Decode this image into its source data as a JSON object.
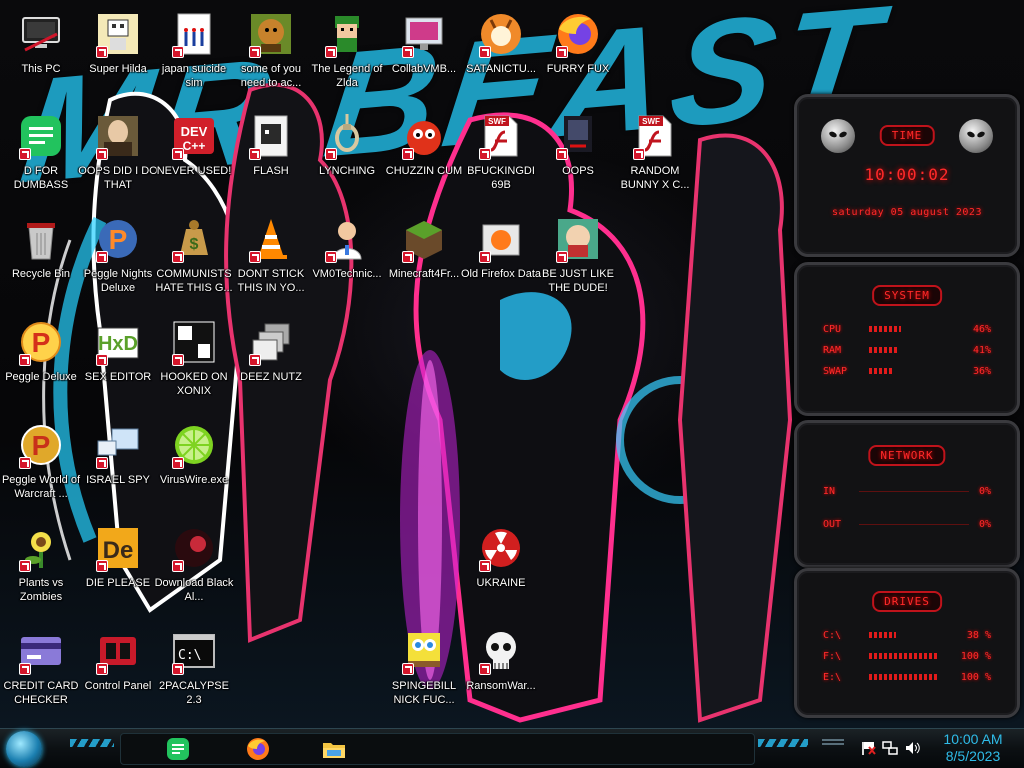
{
  "wallpaper": {
    "title_text": "MR BEAST",
    "accent": "#1fa3c8"
  },
  "desktop_icons": [
    {
      "label": "This PC",
      "icon": "pc-icon"
    },
    {
      "label": "Super Hilda",
      "icon": "super-hilda-icon"
    },
    {
      "label": "japan suicide sim",
      "icon": "japan-suicide-sim-icon"
    },
    {
      "label": "some of you need to ac...",
      "icon": "dog-game-icon"
    },
    {
      "label": "The Legend of Zlda",
      "icon": "zelda-icon"
    },
    {
      "label": "CollabVMB...",
      "icon": "collabvm-icon"
    },
    {
      "label": "SATANICTU...",
      "icon": "satanic-icon"
    },
    {
      "label": "FURRY FUX",
      "icon": "firefox-icon"
    },
    {
      "label": "D FOR DUMBASS",
      "icon": "document-green-icon"
    },
    {
      "label": "OOPS DID I DO THAT",
      "icon": "painting-icon"
    },
    {
      "label": "NEVER USED!",
      "icon": "dev-cpp-icon"
    },
    {
      "label": "FLASH",
      "icon": "flash-card-icon"
    },
    {
      "label": "LYNCHING",
      "icon": "noose-icon"
    },
    {
      "label": "CHUZZIN CUM",
      "icon": "chuzzle-icon"
    },
    {
      "label": "BFUCKINGDI 69B",
      "icon": "swf-file-icon"
    },
    {
      "label": "OOPS",
      "icon": "oops-icon"
    },
    {
      "label": "RANDOM BUNNY X C...",
      "icon": "swf-file-icon"
    },
    {
      "label": "Recycle Bin",
      "icon": "recycle-bin-icon"
    },
    {
      "label": "Peggle Nights Deluxe",
      "icon": "peggle-nights-icon"
    },
    {
      "label": "COMMUNISTS HATE THIS G...",
      "icon": "money-bag-icon"
    },
    {
      "label": "DONT STICK THIS IN YO...",
      "icon": "vlc-cone-icon"
    },
    {
      "label": "VM0Technic...",
      "icon": "doctor-icon"
    },
    {
      "label": "Minecraft4Fr...",
      "icon": "minecraft-icon"
    },
    {
      "label": "Old Firefox Data",
      "icon": "old-firefox-data-icon"
    },
    {
      "label": "BE JUST LIKE THE DUDE!",
      "icon": "the-dude-icon"
    },
    {
      "label": "Peggle Deluxe",
      "icon": "peggle-icon"
    },
    {
      "label": "SEX EDITOR",
      "icon": "hex-editor-icon"
    },
    {
      "label": "HOOKED ON XONIX",
      "icon": "xonix-icon"
    },
    {
      "label": "DEEZ NUTZ",
      "icon": "windows-stack-icon"
    },
    {
      "label": "Peggle World of Warcraft ...",
      "icon": "peggle-wow-icon"
    },
    {
      "label": "ISRAEL SPY",
      "icon": "spy-computer-icon"
    },
    {
      "label": "VirusWire.exe",
      "icon": "lime-icon"
    },
    {
      "label": "Plants vs Zombies",
      "icon": "pvz-icon"
    },
    {
      "label": "DIE PLEASE",
      "icon": "de-icon"
    },
    {
      "label": "Download Black Al...",
      "icon": "black-ball-icon"
    },
    {
      "label": "UKRAINE",
      "icon": "radiation-icon"
    },
    {
      "label": "CREDIT CARD CHECKER",
      "icon": "credit-card-icon"
    },
    {
      "label": "Control Panel",
      "icon": "control-panel-icon"
    },
    {
      "label": "2PACALYPSE 2.3",
      "icon": "terminal-icon"
    },
    {
      "label": "SPINGEBILL NICK FUC...",
      "icon": "spongebob-icon"
    },
    {
      "label": "RansomWar...",
      "icon": "skull-icon"
    }
  ],
  "gadgets": {
    "time": {
      "title": "TIME",
      "clock": "10:00:02",
      "date": "saturday 05 august 2023"
    },
    "system": {
      "title": "SYSTEM",
      "rows": [
        {
          "label": "CPU",
          "value": "46%",
          "fill": 0.46
        },
        {
          "label": "RAM",
          "value": "41%",
          "fill": 0.41
        },
        {
          "label": "SWAP",
          "value": "36%",
          "fill": 0.36
        }
      ]
    },
    "network": {
      "title": "NETWORK",
      "rows": [
        {
          "label": "IN",
          "value": "0%"
        },
        {
          "label": "OUT",
          "value": "0%"
        }
      ]
    },
    "drives": {
      "title": "DRIVES",
      "rows": [
        {
          "label": "C:\\",
          "value": "38 %",
          "fill": 0.38
        },
        {
          "label": "F:\\",
          "value": "100 %",
          "fill": 1.0
        },
        {
          "label": "E:\\",
          "value": "100 %",
          "fill": 1.0
        }
      ]
    },
    "accent": "#ff2a2a"
  },
  "taskbar": {
    "pinned": [
      {
        "name": "notes-app",
        "icon": "document-green-icon"
      },
      {
        "name": "firefox",
        "icon": "firefox-icon"
      },
      {
        "name": "file-explorer",
        "icon": "folder-icon"
      }
    ],
    "tray": [
      "flag-icon",
      "network-icon",
      "volume-icon"
    ],
    "clock": {
      "time": "10:00 AM",
      "date": "8/5/2023"
    },
    "accent": "#2fbce8"
  }
}
